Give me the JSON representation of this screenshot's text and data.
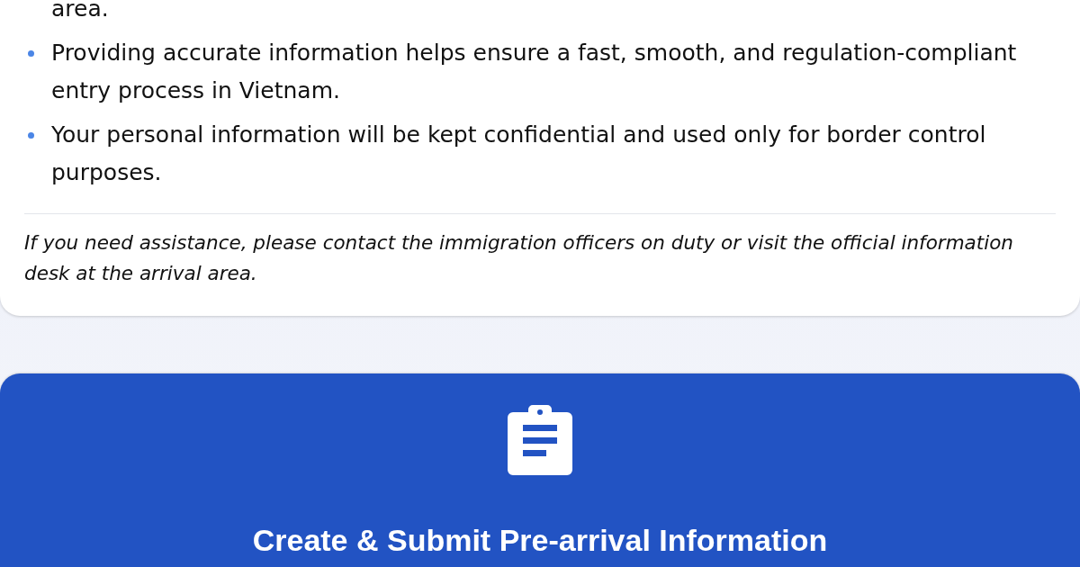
{
  "info_list": [
    {
      "kind": "continuation",
      "text": "area."
    },
    {
      "kind": "bullet",
      "text": "Providing accurate information helps ensure a fast, smooth, and regulation-compliant entry process in Vietnam."
    },
    {
      "kind": "bullet",
      "text": "Your personal information will be kept confidential and used only for border control purposes."
    }
  ],
  "note": "If you need assistance, please contact the immigration officers on duty or visit the official information desk at the arrival area.",
  "action_card": {
    "title": "Create & Submit Pre-arrival Information"
  }
}
